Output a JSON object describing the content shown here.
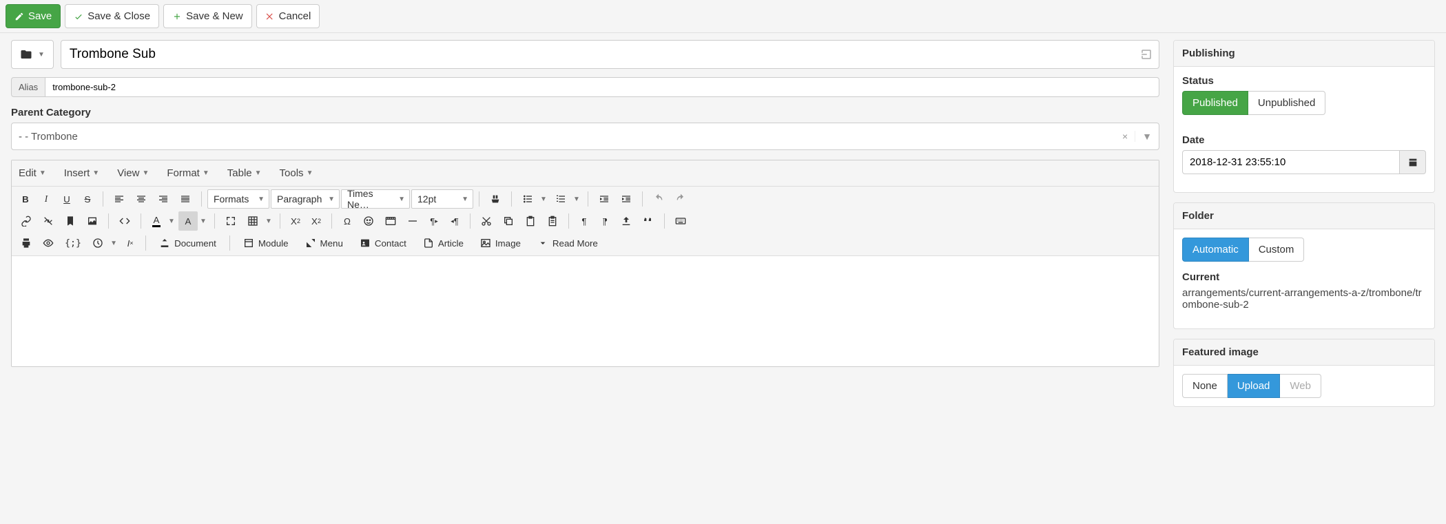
{
  "topbar": {
    "save": "Save",
    "save_close": "Save & Close",
    "save_new": "Save & New",
    "cancel": "Cancel"
  },
  "title": {
    "value": "Trombone Sub"
  },
  "alias": {
    "label": "Alias",
    "value": "trombone-sub-2"
  },
  "parent": {
    "label": "Parent Category",
    "selected": "- - Trombone"
  },
  "editor": {
    "menus": [
      "Edit",
      "Insert",
      "View",
      "Format",
      "Table",
      "Tools"
    ],
    "formats_label": "Formats",
    "block": "Paragraph",
    "font": "Times Ne…",
    "size": "12pt",
    "insert_labels": {
      "document": "Document",
      "module": "Module",
      "menu": "Menu",
      "contact": "Contact",
      "article": "Article",
      "image": "Image",
      "readmore": "Read More"
    }
  },
  "publishing": {
    "heading": "Publishing",
    "status_label": "Status",
    "status": {
      "published": "Published",
      "unpublished": "Unpublished"
    },
    "date_label": "Date",
    "date_value": "2018-12-31 23:55:10"
  },
  "folder": {
    "heading": "Folder",
    "automatic": "Automatic",
    "custom": "Custom",
    "current_label": "Current",
    "current_path": "arrangements/current-arrangements-a-z/trombone/trombone-sub-2"
  },
  "featured": {
    "heading": "Featured image",
    "none": "None",
    "upload": "Upload",
    "web": "Web"
  }
}
